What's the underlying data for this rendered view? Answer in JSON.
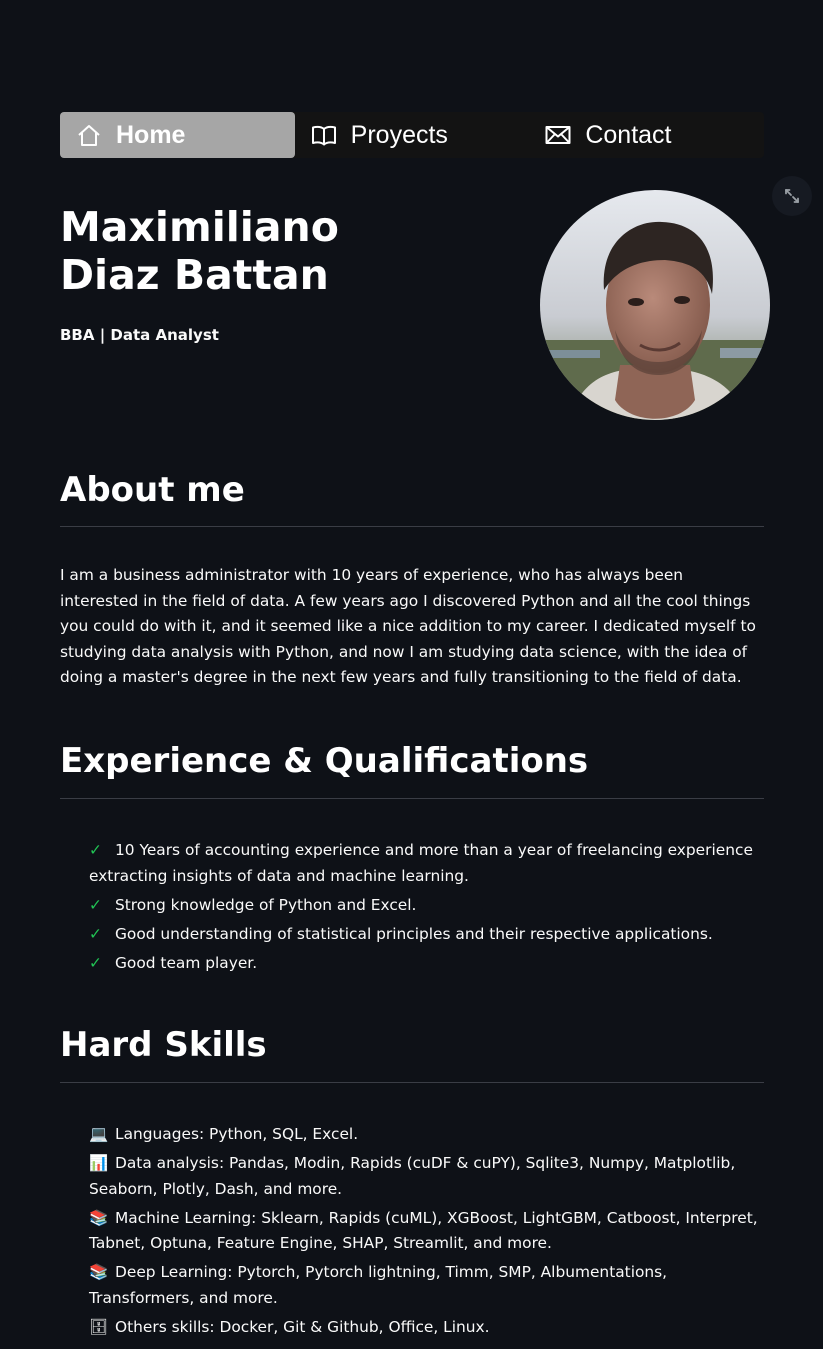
{
  "nav": {
    "items": [
      {
        "label": "Home",
        "icon": "house-icon",
        "active": true
      },
      {
        "label": "Proyects",
        "icon": "book-icon",
        "active": false
      },
      {
        "label": "Contact",
        "icon": "envelope-icon",
        "active": false
      }
    ]
  },
  "header": {
    "name_line1": "Maximiliano",
    "name_line2": "Diaz Battan",
    "subtitle": "BBA | Data Analyst"
  },
  "about": {
    "title": "About me",
    "text": "I am a business administrator with 10 years of experience, who has always been interested in the field of data. A few years ago I discovered Python and all the cool things you could do with it, and it seemed like a nice addition to my career. I dedicated myself to studying data analysis with Python, and now I am studying data science, with the idea of doing a master's degree in the next few years and fully transitioning to the field of data."
  },
  "experience": {
    "title": "Experience & Qualifications",
    "check_glyph": "✓",
    "items": [
      "10 Years of accounting experience and more than a year of freelancing experience extracting insights of data and machine learning.",
      "Strong knowledge of Python and Excel.",
      "Good understanding of statistical principles and their respective applications.",
      "Good team player."
    ]
  },
  "skills": {
    "title": "Hard Skills",
    "items": [
      {
        "icon": "laptop-icon",
        "glyph": "💻",
        "text": "Languages: Python, SQL, Excel."
      },
      {
        "icon": "bar-chart-icon",
        "glyph": "📊",
        "text": "Data analysis: Pandas, Modin, Rapids (cuDF & cuPY), Sqlite3, Numpy, Matplotlib, Seaborn, Plotly, Dash, and more."
      },
      {
        "icon": "books-icon",
        "glyph": "📚",
        "text": "Machine Learning: Sklearn, Rapids (cuML), XGBoost, LightGBM, Catboost, Interpret, Tabnet, Optuna, Feature Engine, SHAP, Streamlit, and more."
      },
      {
        "icon": "books-icon",
        "glyph": "📚",
        "text": "Deep Learning: Pytorch, Pytorch lightning, Timm, SMP, Albumentations, Transformers, and more."
      },
      {
        "icon": "file-cabinet-icon",
        "glyph": "🗄",
        "text": "Others skills: Docker, Git & Github, Office, Linux."
      }
    ]
  },
  "colors": {
    "background": "#0e1117",
    "nav_bg": "#131313",
    "nav_active": "#a6a6a6",
    "check": "#21c354",
    "divider": "#3a3d45"
  }
}
